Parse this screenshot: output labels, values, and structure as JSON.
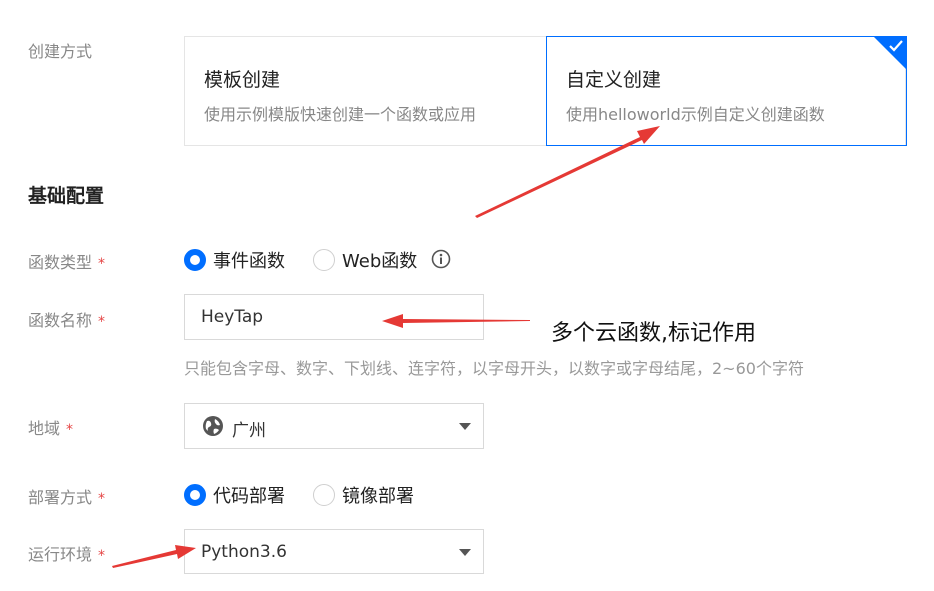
{
  "form": {
    "create_method": {
      "label": "创建方式",
      "options": [
        {
          "title": "模板创建",
          "desc": "使用示例模版快速创建一个函数或应用",
          "selected": false
        },
        {
          "title": "自定义创建",
          "desc": "使用helloworld示例自定义创建函数",
          "selected": true
        }
      ]
    },
    "section_title": "基础配置",
    "function_type": {
      "label": "函数类型",
      "required": "*",
      "options": [
        {
          "label": "事件函数",
          "selected": true
        },
        {
          "label": "Web函数",
          "selected": false
        }
      ]
    },
    "function_name": {
      "label": "函数名称",
      "required": "*",
      "value": "HeyTap",
      "hint": "只能包含字母、数字、下划线、连字符，以字母开头，以数字或字母结尾，2~60个字符"
    },
    "region": {
      "label": "地域",
      "required": "*",
      "value": "广州"
    },
    "deploy_method": {
      "label": "部署方式",
      "required": "*",
      "options": [
        {
          "label": "代码部署",
          "selected": true
        },
        {
          "label": "镜像部署",
          "selected": false
        }
      ]
    },
    "runtime": {
      "label": "运行环境",
      "required": "*",
      "value": "Python3.6"
    }
  },
  "annotations": {
    "name_note": "多个云函数,标记作用"
  },
  "colors": {
    "accent": "#006eff",
    "required": "#e54545",
    "arrow": "#e53935"
  },
  "icons": [
    "check-icon",
    "info-icon",
    "globe-icon",
    "chevron-down-icon"
  ]
}
